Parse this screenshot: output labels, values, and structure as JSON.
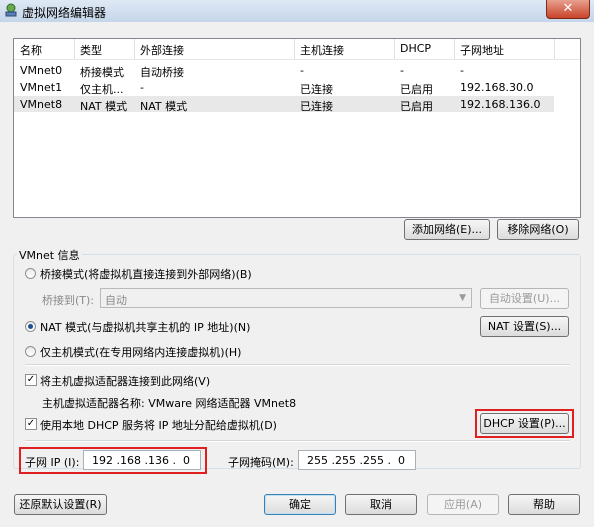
{
  "window": {
    "title": "虚拟网络编辑器",
    "close_label": "✕"
  },
  "network_table": {
    "columns": [
      "名称",
      "类型",
      "外部连接",
      "主机连接",
      "DHCP",
      "子网地址"
    ],
    "rows": [
      [
        "VMnet0",
        "桥接模式",
        "自动桥接",
        "-",
        "-",
        "-"
      ],
      [
        "VMnet1",
        "仅主机...",
        "-",
        "已连接",
        "已启用",
        "192.168.30.0"
      ],
      [
        "VMnet8",
        "NAT 模式",
        "NAT 模式",
        "已连接",
        "已启用",
        "192.168.136.0"
      ]
    ],
    "selected_row": 2
  },
  "list_buttons": {
    "add_network": "添加网络(E)...",
    "remove_network": "移除网络(O)"
  },
  "vmnet_info": {
    "title": "VMnet 信息",
    "bridged_radio": "桥接模式(将虚拟机直接连接到外部网络)(B)",
    "bridged_to_label": "桥接到(T):",
    "bridged_to_value": "自动",
    "auto_settings": "自动设置(U)...",
    "nat_radio": "NAT 模式(与虚拟机共享主机的 IP 地址)(N)",
    "nat_settings": "NAT 设置(S)...",
    "hostonly_radio": "仅主机模式(在专用网络内连接虚拟机)(H)",
    "selected_mode": "nat",
    "connect_adapter_check": "将主机虚拟适配器连接到此网络(V)",
    "adapter_name": "主机虚拟适配器名称: VMware 网络适配器 VMnet8",
    "dhcp_check": "使用本地 DHCP 服务将 IP 地址分配给虚拟机(D)",
    "dhcp_settings": "DHCP 设置(P)...",
    "subnet_ip_label": "子网 IP (I):",
    "subnet_ip": "192 .168 .136 .  0",
    "subnet_mask_label": "子网掩码(M):",
    "subnet_mask": "255 .255 .255 .  0"
  },
  "footer": {
    "restore_defaults": "还原默认设置(R)",
    "ok": "确定",
    "cancel": "取消",
    "apply": "应用(A)",
    "help": "帮助"
  },
  "colors": {
    "highlight_border": "#e02020",
    "selected_row": "#e8e8e8"
  }
}
